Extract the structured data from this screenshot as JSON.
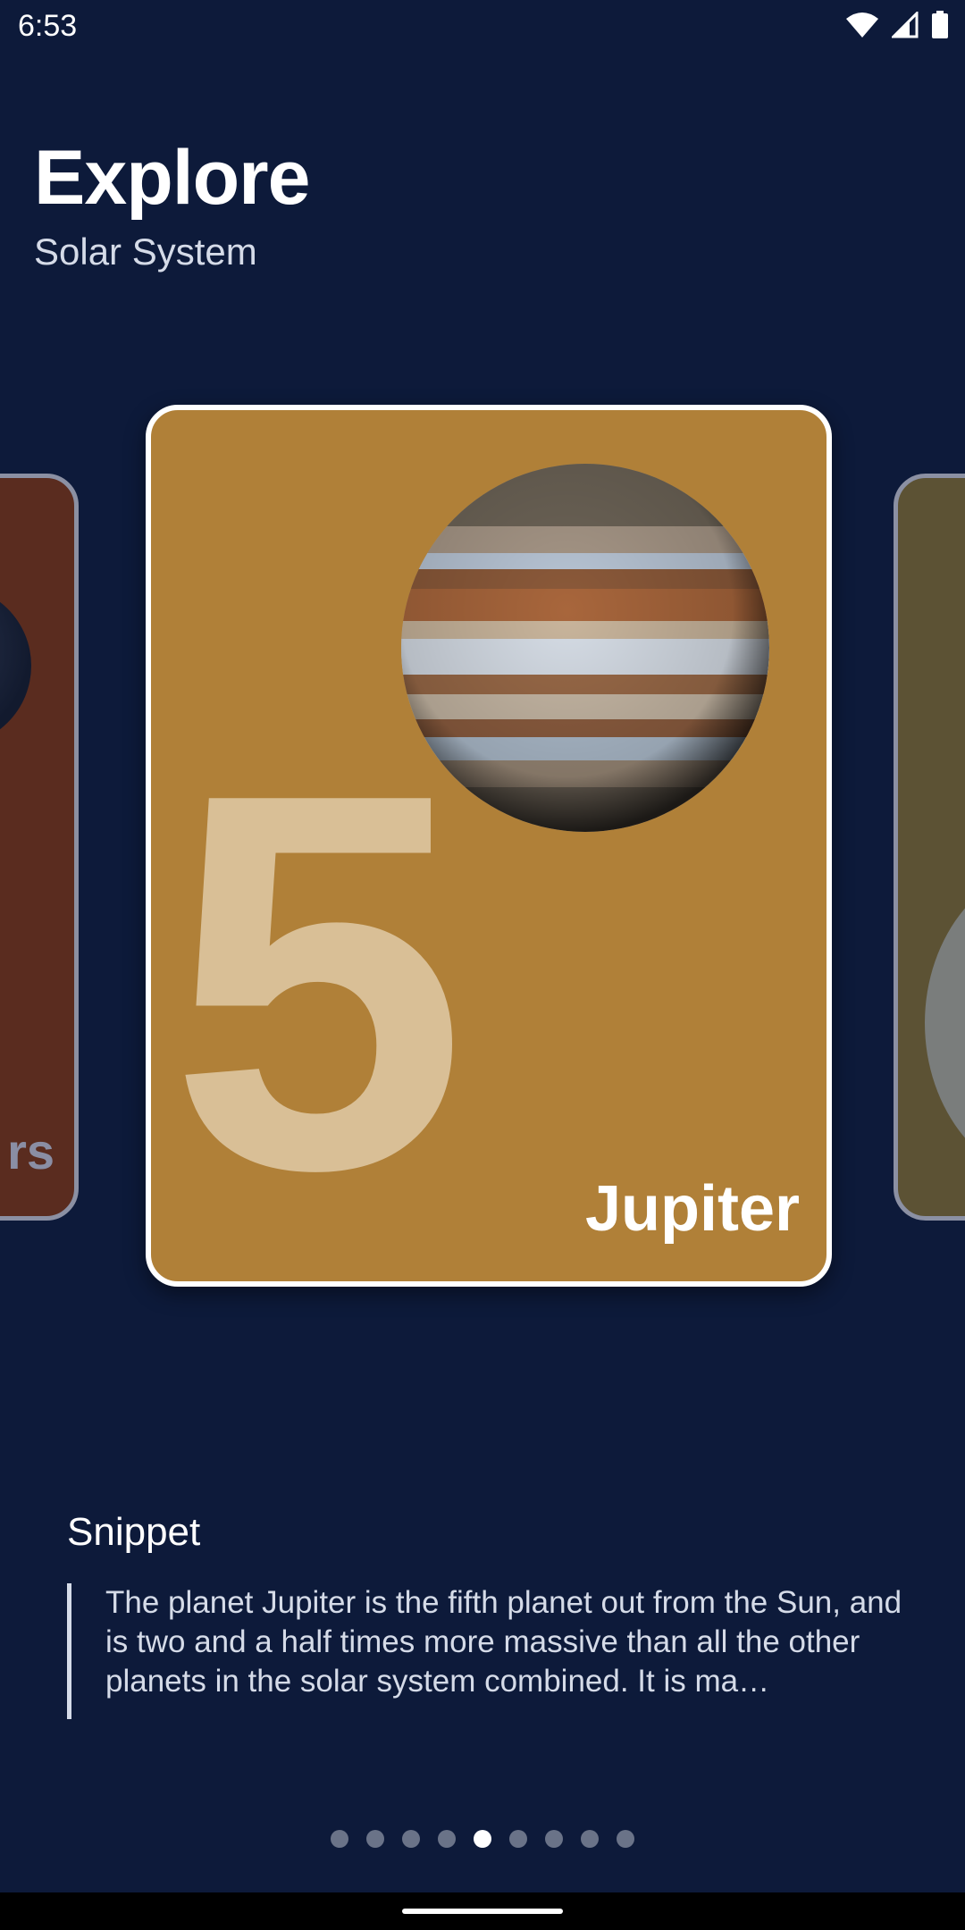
{
  "status_bar": {
    "time": "6:53",
    "icons": [
      "wifi-icon",
      "signal-icon",
      "battery-icon"
    ]
  },
  "header": {
    "title": "Explore",
    "subtitle": "Solar System"
  },
  "carousel": {
    "prev_card": {
      "name_partial": "rs",
      "color": "#5a2c1f"
    },
    "current_card": {
      "number": "5",
      "name": "Jupiter",
      "color": "#b08038",
      "number_color": "#d9bf96"
    },
    "next_card": {
      "color": "#5c5234"
    }
  },
  "snippet": {
    "title": "Snippet",
    "text": "The planet Jupiter is the fifth planet out from the Sun, and is two and a half times more massive than all the other planets in the solar system combined. It is ma…"
  },
  "pager": {
    "total": 9,
    "active_index": 4
  },
  "colors": {
    "background": "#0d1a3a",
    "accent_text": "#d5dbe8"
  }
}
